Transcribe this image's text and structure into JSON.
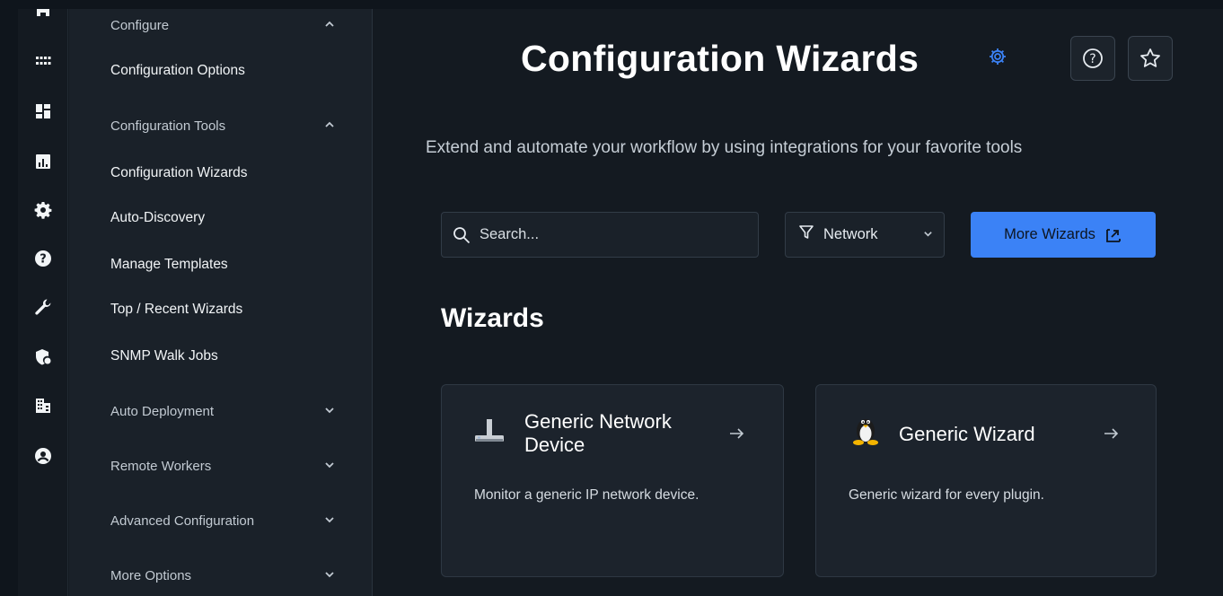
{
  "menu": {
    "section_configure": "Configure",
    "configuration_options": "Configuration Options",
    "section_tools": "Configuration Tools",
    "items": [
      "Configuration Wizards",
      "Auto-Discovery",
      "Manage Templates",
      "Top / Recent Wizards",
      "SNMP Walk Jobs"
    ],
    "section_auto_deployment": "Auto Deployment",
    "section_remote_workers": "Remote Workers",
    "section_advanced": "Advanced Configuration",
    "section_more": "More Options"
  },
  "rail_icons": [
    "home-icon",
    "grid-icon",
    "dashboard-icon",
    "chart-icon",
    "gear-icon",
    "help-icon",
    "wrench-icon",
    "shield-user-icon",
    "building-icon",
    "user-circle-icon"
  ],
  "header": {
    "title": "Configuration Wizards",
    "subtitle": "Extend and automate your workflow by using integrations for your favorite tools"
  },
  "search": {
    "placeholder": "Search..."
  },
  "filter": {
    "value": "Network"
  },
  "more_wizards": {
    "label": "More Wizards"
  },
  "wizards": {
    "heading": "Wizards",
    "cards": [
      {
        "title_line1": "Generic Network",
        "title_line2": "Device",
        "description": "Monitor a generic IP network device."
      },
      {
        "title": "Generic Wizard",
        "description": "Generic wizard for every plugin."
      }
    ]
  },
  "colors": {
    "accent": "#3b82f6",
    "background": "#141a21",
    "sidebar": "#1a2129"
  }
}
